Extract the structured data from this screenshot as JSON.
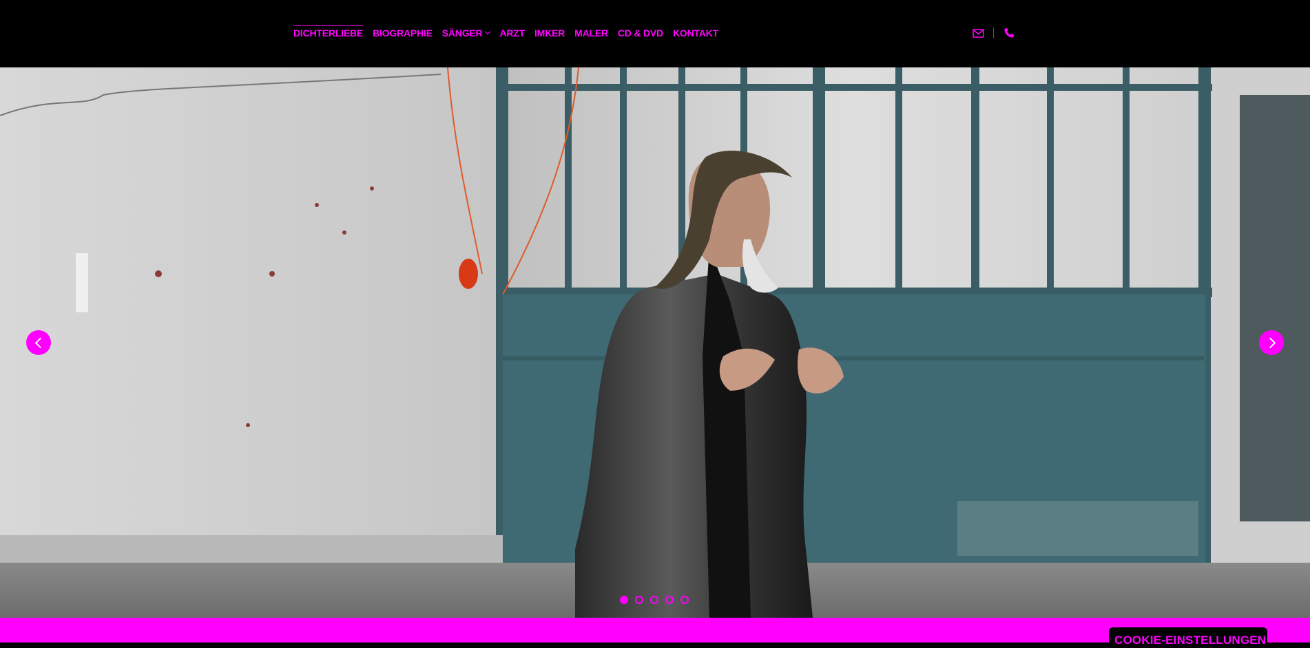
{
  "nav": {
    "items": [
      {
        "label": "DICHTERLIEBE",
        "active": true
      },
      {
        "label": "BIOGRAPHIE"
      },
      {
        "label": "SÄNGER",
        "has_dropdown": true
      },
      {
        "label": "ARZT"
      },
      {
        "label": "IMKER"
      },
      {
        "label": "MALER"
      },
      {
        "label": "CD & DVD"
      },
      {
        "label": "KONTAKT"
      }
    ]
  },
  "header_icons": [
    "envelope-icon",
    "phone-icon"
  ],
  "slider": {
    "slide_count": 5,
    "active_index": 0,
    "prev_icon": "chevron-left-icon",
    "next_icon": "chevron-right-icon"
  },
  "cookie": {
    "label": "COOKIE-EINSTELLUNGEN"
  },
  "colors": {
    "accent": "#ff00ff",
    "header_bg": "#000000"
  }
}
